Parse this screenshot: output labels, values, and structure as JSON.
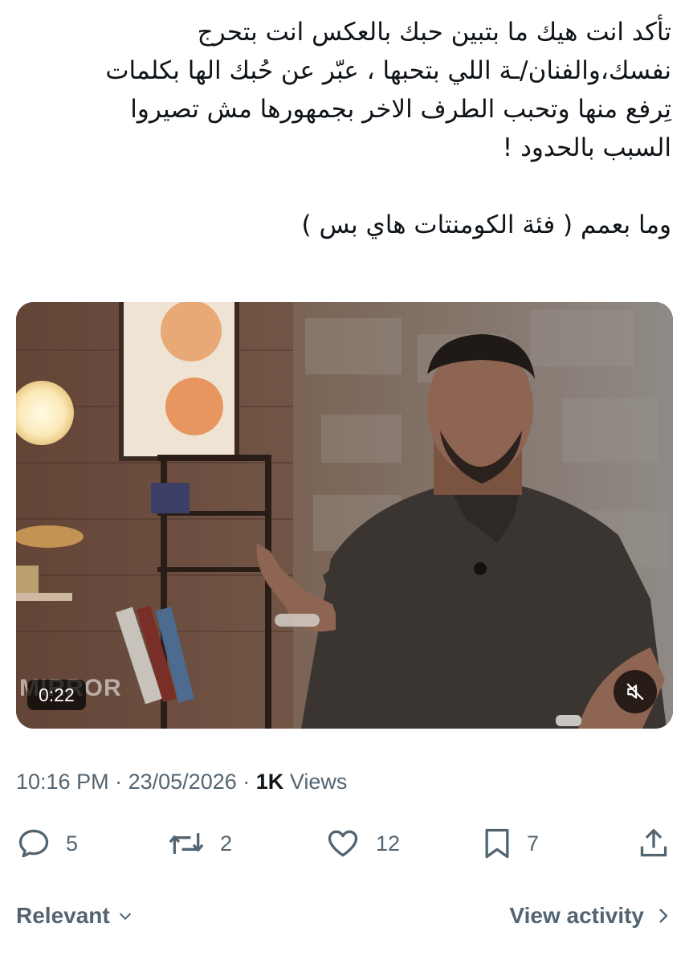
{
  "tweet": {
    "lines": [
      "تأكد انت هيك ما بتبين حبك بالعكس انت بتحرج",
      "نفسك،والفنان/ـة اللي بتحبها ، عبّر عن حُبك الها بكلمات",
      "تِرفع منها وتحبب الطرف الاخر بجمهورها مش تصيروا",
      "السبب بالحدود !",
      "",
      "وما بعمم ( فئة الكومنتات هاي بس )"
    ]
  },
  "video": {
    "duration": "0:22",
    "watermark": "MIRROR",
    "mute_icon": "muted-speaker-icon"
  },
  "meta": {
    "time": "10:16 PM",
    "separator": "·",
    "date": "23/05/2026",
    "views_count": "1K",
    "views_label": "Views"
  },
  "actions": {
    "replies": "5",
    "reposts": "2",
    "likes": "12",
    "bookmarks": "7"
  },
  "footer": {
    "sort_label": "Relevant",
    "activity_label": "View activity"
  },
  "colors": {
    "text": "#0f1419",
    "secondary": "#536471"
  }
}
